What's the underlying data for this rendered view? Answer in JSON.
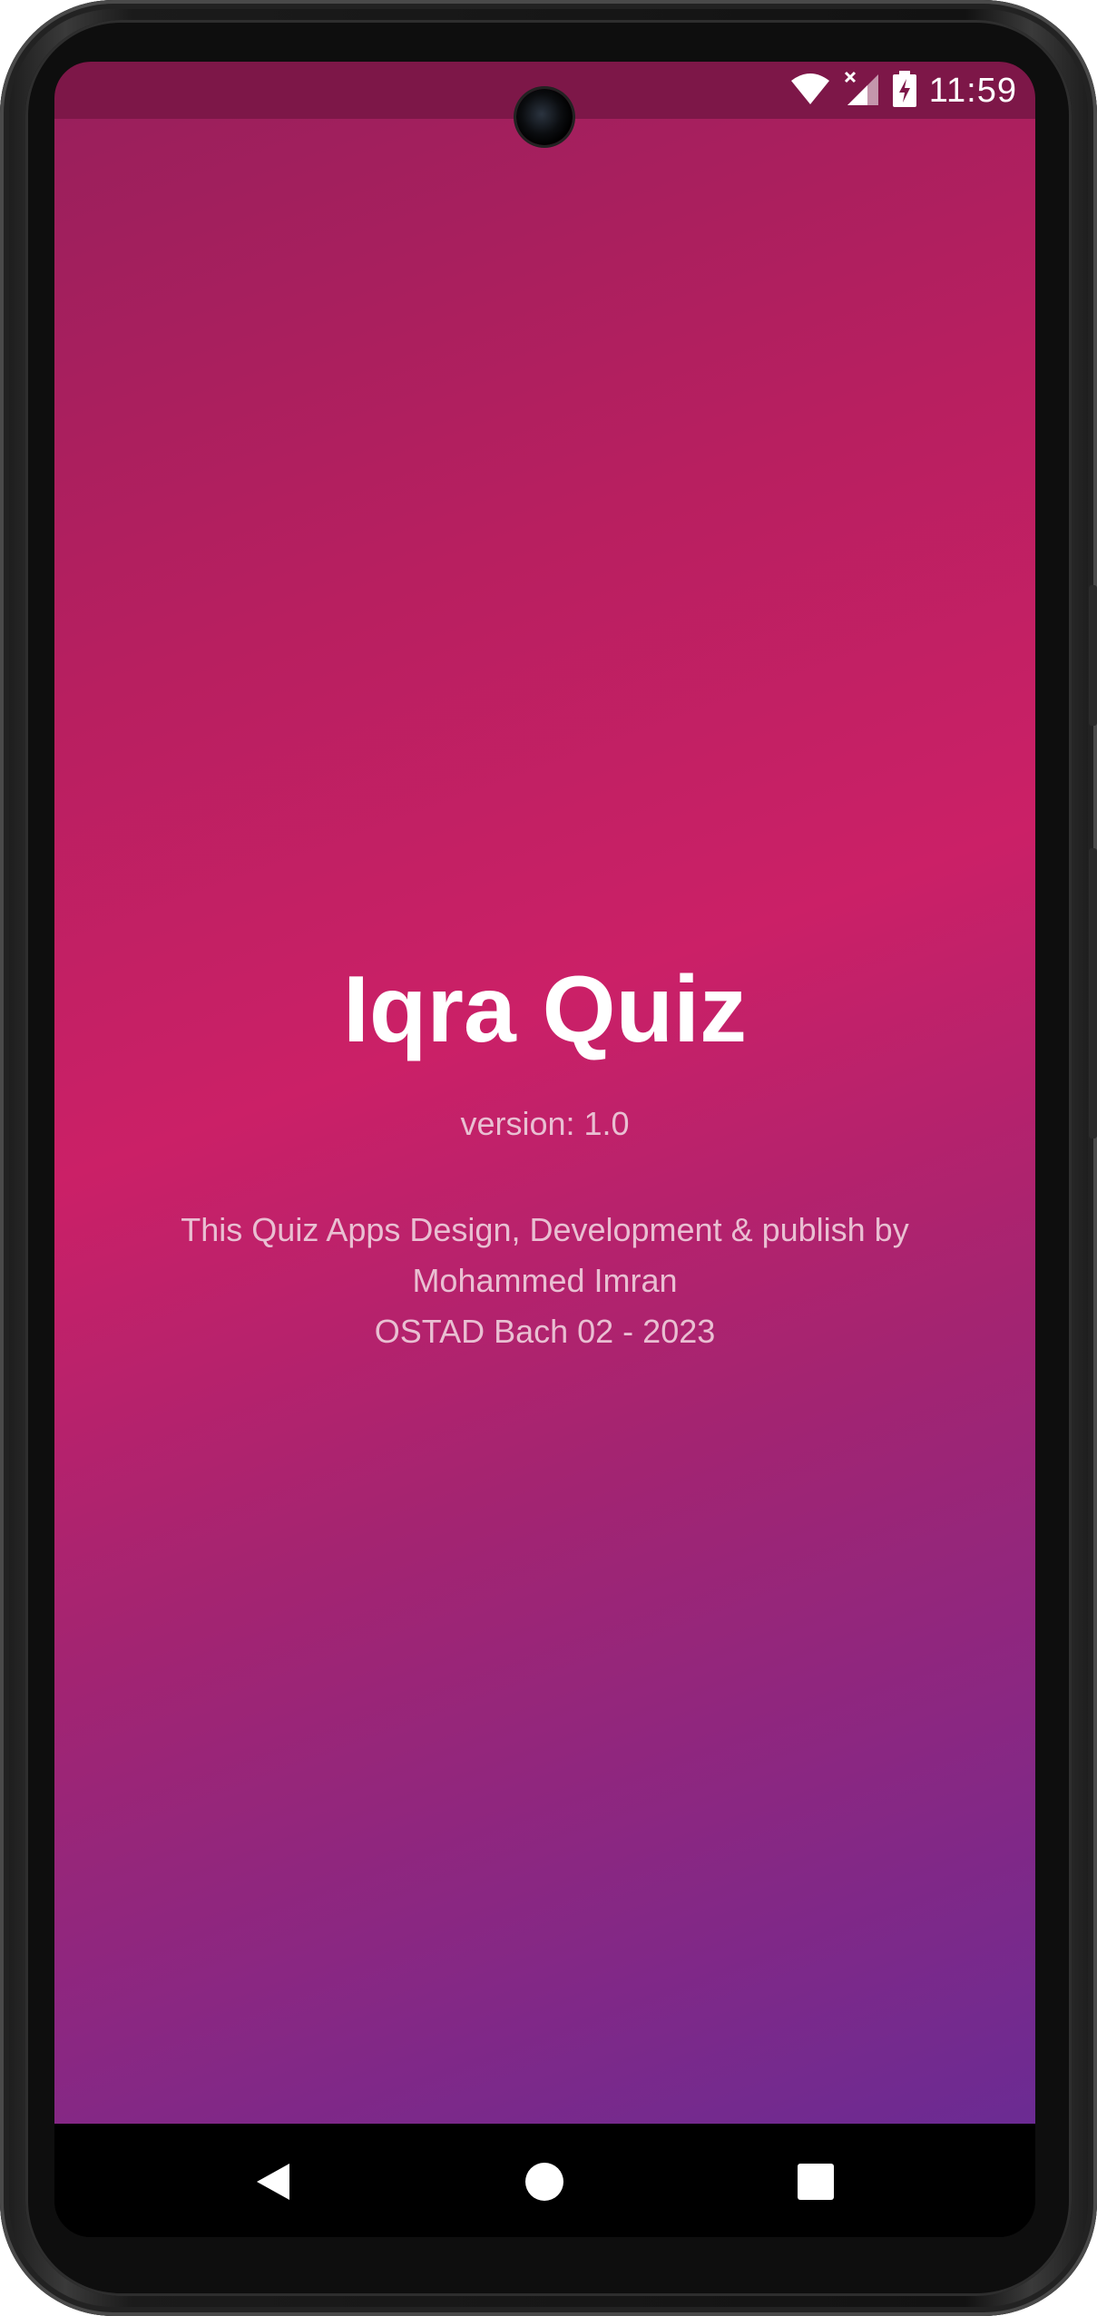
{
  "status_bar": {
    "time": "11:59",
    "icons": [
      "wifi-icon",
      "signal-off-icon",
      "battery-charging-icon"
    ]
  },
  "app": {
    "title": "Iqra Quiz",
    "version": "version: 1.0",
    "credits": [
      "This Quiz Apps Design, Development & publish by",
      "Mohammed Imran",
      "OSTAD Bach 02 - 2023"
    ],
    "gradient_colors": [
      "#9a1f5c",
      "#cb2067",
      "#6b2b93"
    ]
  },
  "nav_bar": {
    "buttons": [
      "back-icon",
      "home-icon",
      "recents-icon"
    ]
  }
}
